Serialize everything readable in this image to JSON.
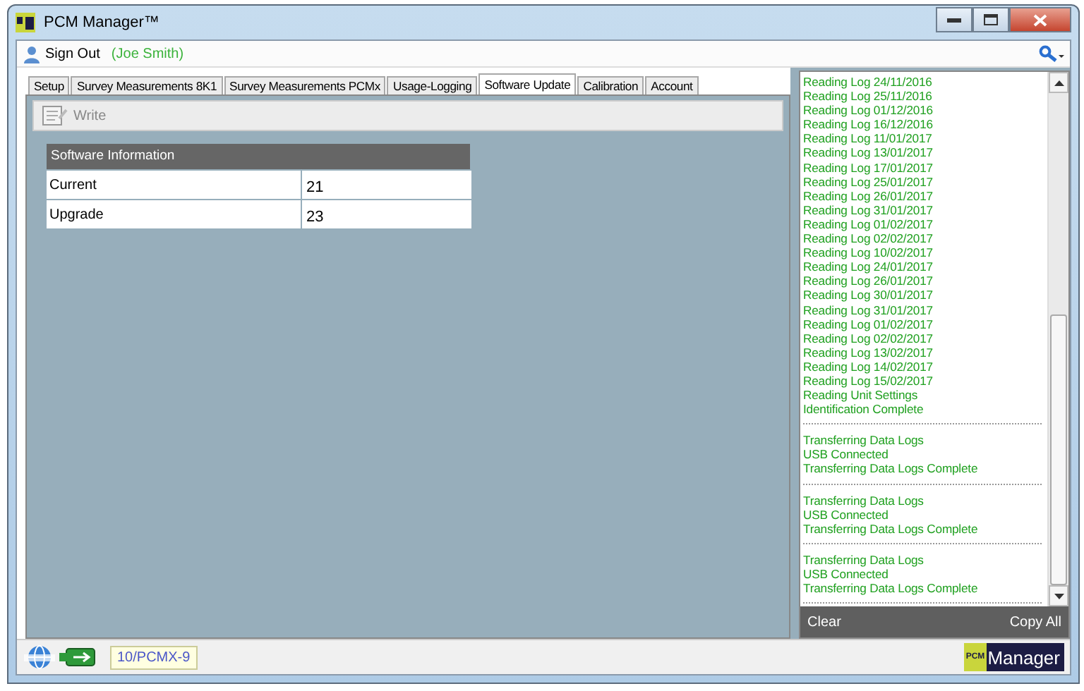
{
  "window": {
    "title": "PCM Manager™"
  },
  "toolbar": {
    "sign_out": "Sign Out",
    "user": "(Joe Smith)"
  },
  "tabs": [
    {
      "label": "Setup",
      "selected": false
    },
    {
      "label": "Survey Measurements 8K1",
      "selected": false
    },
    {
      "label": "Survey Measurements PCMx",
      "selected": false
    },
    {
      "label": "Usage-Logging",
      "selected": false
    },
    {
      "label": "Software Update",
      "selected": true
    },
    {
      "label": "Calibration",
      "selected": false
    },
    {
      "label": "Account",
      "selected": false
    }
  ],
  "actions": [
    {
      "label": "Write",
      "disabled": true
    }
  ],
  "software_info": {
    "title": "Software Information",
    "rows": [
      {
        "label": "Current",
        "value": "21"
      },
      {
        "label": "Upgrade",
        "value": "23"
      }
    ]
  },
  "log": {
    "groups": [
      {
        "lines": [
          "Reading Log  24/11/2016",
          "Reading Log  25/11/2016",
          "Reading Log  01/12/2016",
          "Reading Log  16/12/2016",
          "Reading Log  11/01/2017",
          "Reading Log  13/01/2017",
          "Reading Log  17/01/2017",
          "Reading Log  25/01/2017",
          "Reading Log  26/01/2017",
          "Reading Log  31/01/2017",
          "Reading Log  01/02/2017",
          "Reading Log  02/02/2017",
          "Reading Log  10/02/2017",
          "Reading Log  24/01/2017",
          "Reading Log  26/01/2017",
          "Reading Log  30/01/2017",
          "Reading Log  31/01/2017",
          "Reading Log  01/02/2017",
          "Reading Log  02/02/2017",
          "Reading Log  13/02/2017",
          "Reading Log  14/02/2017",
          "Reading Log  15/02/2017",
          "Reading Unit Settings",
          "Identification Complete"
        ]
      },
      {
        "lines": [
          "Transferring Data Logs",
          "USB Connected",
          "Transferring Data Logs Complete"
        ]
      },
      {
        "lines": [
          "Transferring Data Logs",
          "USB Connected",
          "Transferring Data Logs Complete"
        ]
      },
      {
        "lines": [
          "Transferring Data Logs",
          "USB Connected",
          "Transferring Data Logs Complete"
        ]
      }
    ],
    "clear": "Clear",
    "copy_all": "Copy All"
  },
  "status_bar": {
    "device": "10/PCMX-9",
    "logo_small": "PCM",
    "logo_text": "Manager"
  }
}
